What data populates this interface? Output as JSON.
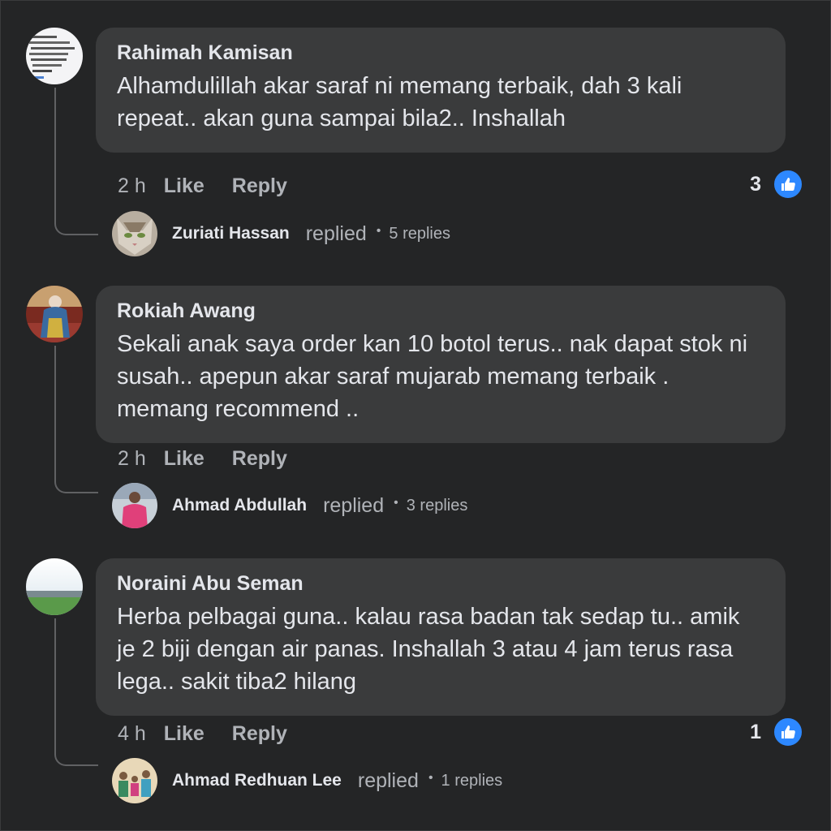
{
  "comments": [
    {
      "author": "Rahimah Kamisan",
      "text": "Alhamdulillah akar saraf ni memang terbaik, dah 3 kali repeat.. akan guna sampai bila2.. Inshallah",
      "time": "2 h",
      "like_label": "Like",
      "reply_label": "Reply",
      "reaction_count": "3",
      "reaction_icon": "like-icon",
      "avatar_icon": "text-image-avatar",
      "reply_preview": {
        "name": "Zuriati Hassan",
        "replied": "replied",
        "dot": "•",
        "count": "5 replies",
        "avatar_icon": "cat-avatar"
      }
    },
    {
      "author": "Rokiah Awang",
      "text": "Sekali anak saya order kan 10 botol terus.. nak dapat stok ni susah.. apepun akar saraf mujarab memang terbaik . memang recommend ..",
      "time": "2 h",
      "like_label": "Like",
      "reply_label": "Reply",
      "reaction_count": "",
      "avatar_icon": "woman-avatar",
      "reply_preview": {
        "name": "Ahmad Abdullah",
        "replied": "replied",
        "dot": "•",
        "count": "3 replies",
        "avatar_icon": "person-pink-avatar"
      }
    },
    {
      "author": "Noraini Abu Seman",
      "text": "Herba pelbagai guna.. kalau rasa badan tak sedap tu.. amik je 2 biji dengan air panas. Inshallah 3 atau 4 jam terus rasa lega.. sakit tiba2 hilang",
      "time": "4 h",
      "like_label": "Like",
      "reply_label": "Reply",
      "reaction_count": "1",
      "reaction_icon": "like-icon",
      "avatar_icon": "landscape-avatar",
      "reply_preview": {
        "name": "Ahmad Redhuan Lee",
        "replied": "replied",
        "dot": "•",
        "count": "1 replies",
        "avatar_icon": "family-avatar"
      }
    }
  ],
  "colors": {
    "background": "#242526",
    "bubble": "#3a3b3c",
    "primary_text": "#e4e6eb",
    "secondary_text": "#b0b3b8",
    "like_blue": "#2d88ff"
  }
}
